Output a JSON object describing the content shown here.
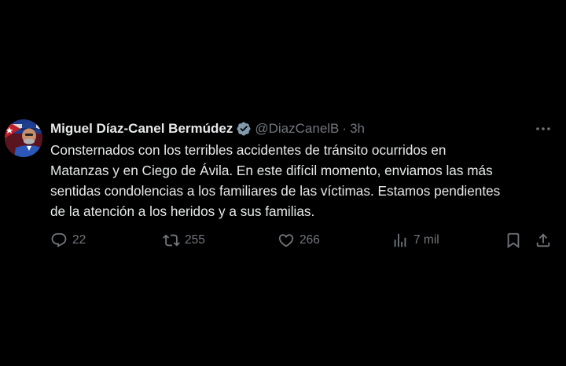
{
  "author": {
    "name": "Miguel Díaz-Canel Bermúdez",
    "handle": "@DiazCanelB",
    "separator": "·",
    "time": "3h"
  },
  "tweet": {
    "lines": [
      "Consternados con los terribles accidentes de tránsito ocurridos en",
      "Matanzas y en Ciego de Ávila. En este difícil momento, enviamos las más",
      "sentidas condolencias a los familiares de las víctimas. Estamos pendientes",
      "de la atención a los heridos y a sus familias."
    ]
  },
  "actions": {
    "replies": "22",
    "reposts": "255",
    "likes": "266",
    "views": "7 mil"
  },
  "icons": {
    "verified": "verified-badge-icon",
    "more": "more-icon",
    "reply": "reply-icon",
    "repost": "repost-icon",
    "like": "heart-icon",
    "views": "views-icon",
    "bookmark": "bookmark-icon",
    "share": "share-icon"
  },
  "colors": {
    "background": "#000000",
    "text": "#e7e9ea",
    "muted": "#71767b",
    "verified": "#829aab"
  }
}
